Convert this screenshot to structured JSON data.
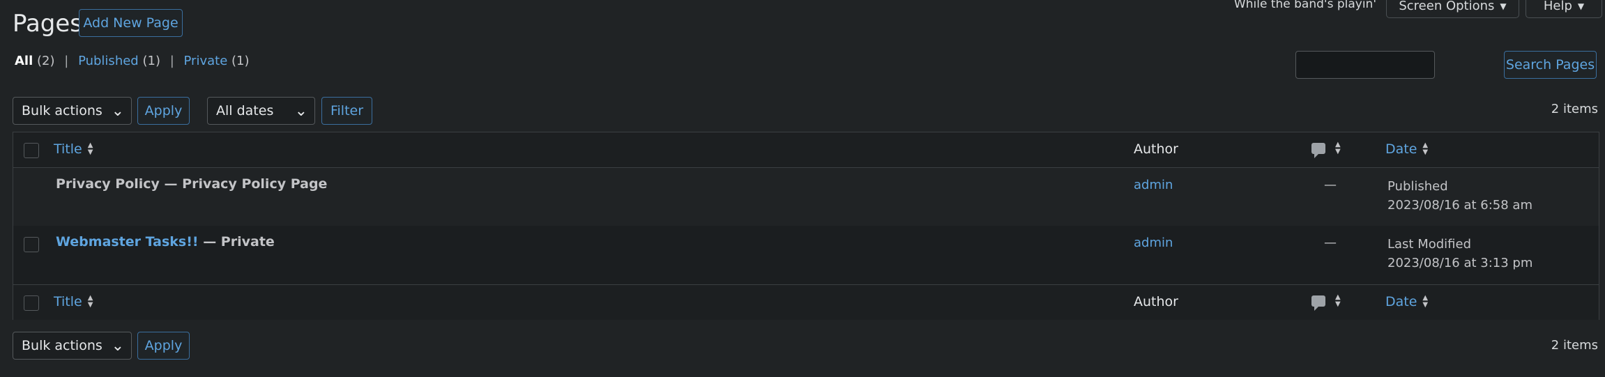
{
  "header": {
    "title": "Pages",
    "add_new_label": "Add New Page",
    "motd": "While the band's playin'",
    "screen_options_label": "Screen Options",
    "help_label": "Help"
  },
  "views": {
    "all_label": "All",
    "all_count": "(2)",
    "published_label": "Published",
    "published_count": "(1)",
    "private_label": "Private",
    "private_count": "(1)",
    "separator": "|"
  },
  "search": {
    "value": "",
    "button_label": "Search Pages"
  },
  "tablenav_top": {
    "bulk_actions": "Bulk actions",
    "apply_label": "Apply",
    "dates_filter": "All dates",
    "filter_label": "Filter",
    "items_count": "2 items"
  },
  "tablenav_bottom": {
    "bulk_actions": "Bulk actions",
    "apply_label": "Apply",
    "items_count": "2 items"
  },
  "table": {
    "columns": {
      "title": "Title",
      "author": "Author",
      "date": "Date"
    },
    "rows": [
      {
        "title": "Privacy Policy",
        "state": " — Privacy Policy Page",
        "author": "admin",
        "comments": "—",
        "date_status": "Published",
        "date_value": "2023/08/16 at 6:58 am"
      },
      {
        "title": "Webmaster Tasks!!",
        "state": " — Private",
        "author": "admin",
        "comments": "—",
        "date_status": "Last Modified",
        "date_value": "2023/08/16 at 3:13 pm"
      }
    ]
  },
  "icons": {
    "sort": "sort-arrows-icon",
    "comments": "comment-bubble-icon",
    "dropdown": "chevron-down-icon"
  }
}
